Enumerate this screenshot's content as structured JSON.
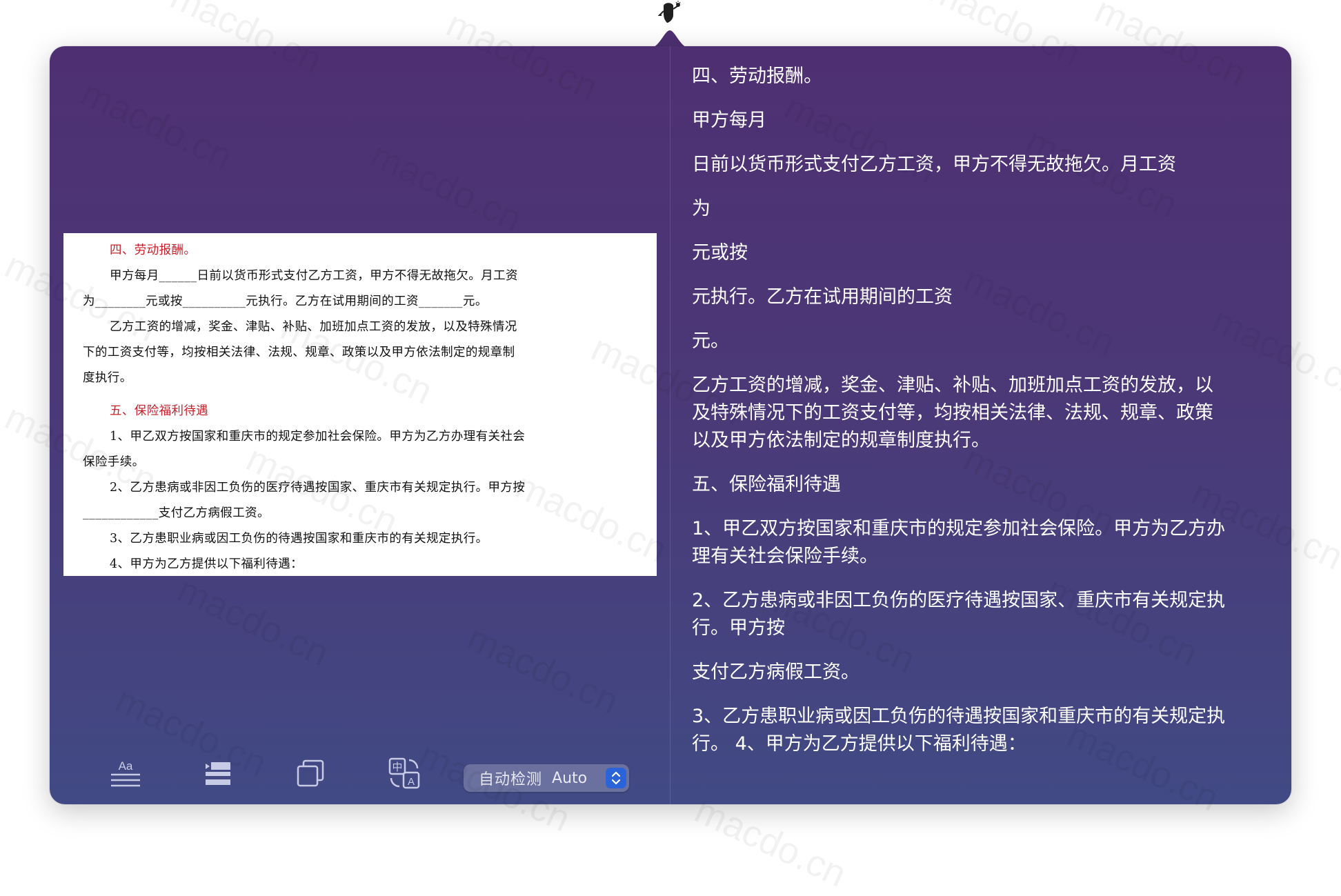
{
  "watermark": "macdo.cn",
  "app": {
    "icon": "bob-translator-mascot-icon"
  },
  "source_document": {
    "lines": [
      {
        "text": "四、劳动报酬。",
        "style": "heading",
        "indent": true
      },
      {
        "text": "甲方每月______日前以货币形式支付乙方工资，甲方不得无故拖欠。月工资",
        "style": "body",
        "indent": true
      },
      {
        "text": "为________元或按__________元执行。乙方在试用期间的工资_______元。",
        "style": "body",
        "indent": false
      },
      {
        "text": "乙方工资的增减，奖金、津贴、补贴、加班加点工资的发放，以及特殊情况",
        "style": "body",
        "indent": true
      },
      {
        "text": "下的工资支付等，均按相关法律、法规、规章、政策以及甲方依法制定的规章制",
        "style": "body",
        "indent": false
      },
      {
        "text": "度执行。",
        "style": "body",
        "indent": false
      },
      {
        "text": "五、保险福利待遇",
        "style": "heading",
        "indent": true
      },
      {
        "text": "1、甲乙双方按国家和重庆市的规定参加社会保险。甲方为乙方办理有关社会",
        "style": "body",
        "indent": true
      },
      {
        "text": "保险手续。",
        "style": "body",
        "indent": false
      },
      {
        "text": "2、乙方患病或非因工负伤的医疗待遇按国家、重庆市有关规定执行。甲方按",
        "style": "body",
        "indent": true
      },
      {
        "text": "____________支付乙方病假工资。",
        "style": "body",
        "indent": false
      },
      {
        "text": "3、乙方患职业病或因工负伤的待遇按国家和重庆市的有关规定执行。",
        "style": "body",
        "indent": true
      },
      {
        "text": "4、甲方为乙方提供以下福利待遇：",
        "style": "body",
        "indent": true
      }
    ]
  },
  "toolbar": {
    "font_button": {
      "icon": "text-format-icon",
      "label": "Aa"
    },
    "list_button": {
      "icon": "list-icon"
    },
    "copy_button": {
      "icon": "copy-icon"
    },
    "translate_button": {
      "icon": "translate-icon",
      "glyph_zh": "中",
      "glyph_en": "A"
    },
    "language_popup": {
      "label": "自动检测",
      "value": "Auto",
      "icon": "chevron-up-down-icon"
    }
  },
  "ocr_result": {
    "paragraphs": [
      [
        "四、劳动报酬。"
      ],
      [
        "甲方每月"
      ],
      [
        "日前以货币形式支付乙方工资，甲方不得无故拖欠。月工资"
      ],
      [
        "为"
      ],
      [
        "元或按"
      ],
      [
        "元执行。乙方在试用期间的工资"
      ],
      [
        "元。"
      ],
      [
        "乙方工资的增减，奖金、津贴、补贴、加班加点工资的发放，以",
        "及特殊情况下的工资支付等，均按相关法律、法规、规章、政策",
        "以及甲方依法制定的规章制度执行。"
      ],
      [
        "五、保险福利待遇"
      ],
      [
        "1、甲乙双方按国家和重庆市的规定参加社会保险。甲方为乙方办",
        "理有关社会保险手续。"
      ],
      [
        "2、乙方患病或非因工负伤的医疗待遇按国家、重庆市有关规定执",
        "行。甲方按"
      ],
      [
        "支付乙方病假工资。"
      ],
      [
        "3、乙方患职业病或因工负伤的待遇按国家和重庆市的有关规定执",
        "行。 4、甲方为乙方提供以下福利待遇："
      ]
    ]
  }
}
